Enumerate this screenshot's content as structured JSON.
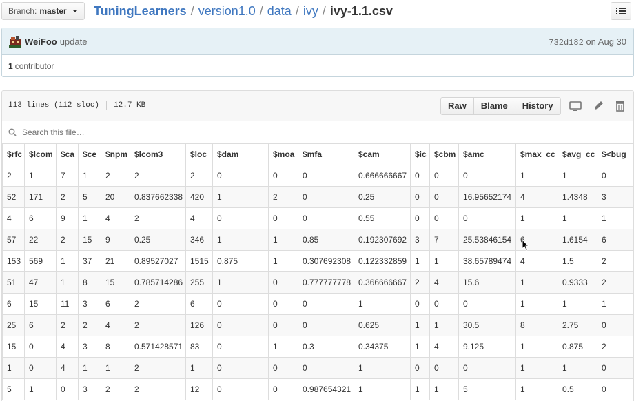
{
  "branch": {
    "prefix": "Branch:",
    "name": "master"
  },
  "breadcrumb": [
    {
      "label": "TuningLearners",
      "kind": "repo"
    },
    {
      "label": "version1.0",
      "kind": "dir"
    },
    {
      "label": "data",
      "kind": "dir"
    },
    {
      "label": "ivy",
      "kind": "dir"
    },
    {
      "label": "ivy-1.1.csv",
      "kind": "file"
    }
  ],
  "breadcrumb_separator": "/",
  "commit": {
    "author": "WeiFoo",
    "message": "update",
    "sha": "732d182",
    "date": "on Aug 30",
    "contributors_count": "1",
    "contributors_label": "contributor"
  },
  "file": {
    "lines": "113 lines (112 sloc)",
    "size": "12.7 KB",
    "buttons": [
      "Raw",
      "Blame",
      "History"
    ],
    "icons": [
      "desktop-icon",
      "pencil-icon",
      "trash-icon"
    ]
  },
  "search": {
    "placeholder": "Search this file…"
  },
  "table": {
    "headers": [
      "$rfc",
      "$lcom",
      "$ca",
      "$ce",
      "$npm",
      "$lcom3",
      "$loc",
      "$dam",
      "$moa",
      "$mfa",
      "$cam",
      "$ic",
      "$cbm",
      "$amc",
      "$max_cc",
      "$avg_cc",
      "$<bug"
    ],
    "rows": [
      [
        "2",
        "1",
        "7",
        "1",
        "2",
        "2",
        "2",
        "0",
        "0",
        "0",
        "0.666666667",
        "0",
        "0",
        "0",
        "1",
        "1",
        "0"
      ],
      [
        "52",
        "171",
        "2",
        "5",
        "20",
        "0.837662338",
        "420",
        "1",
        "2",
        "0",
        "0.25",
        "0",
        "0",
        "16.95652174",
        "4",
        "1.4348",
        "3"
      ],
      [
        "4",
        "6",
        "9",
        "1",
        "4",
        "2",
        "4",
        "0",
        "0",
        "0",
        "0.55",
        "0",
        "0",
        "0",
        "1",
        "1",
        "1"
      ],
      [
        "57",
        "22",
        "2",
        "15",
        "9",
        "0.25",
        "346",
        "1",
        "1",
        "0.85",
        "0.192307692",
        "3",
        "7",
        "25.53846154",
        "6",
        "1.6154",
        "6"
      ],
      [
        "153",
        "569",
        "1",
        "37",
        "21",
        "0.89527027",
        "1515",
        "0.875",
        "1",
        "0.307692308",
        "0.122332859",
        "1",
        "1",
        "38.65789474",
        "4",
        "1.5",
        "2"
      ],
      [
        "51",
        "47",
        "1",
        "8",
        "15",
        "0.785714286",
        "255",
        "1",
        "0",
        "0.777777778",
        "0.366666667",
        "2",
        "4",
        "15.6",
        "1",
        "0.9333",
        "2"
      ],
      [
        "6",
        "15",
        "11",
        "3",
        "6",
        "2",
        "6",
        "0",
        "0",
        "0",
        "1",
        "0",
        "0",
        "0",
        "1",
        "1",
        "1"
      ],
      [
        "25",
        "6",
        "2",
        "2",
        "4",
        "2",
        "126",
        "0",
        "0",
        "0",
        "0.625",
        "1",
        "1",
        "30.5",
        "8",
        "2.75",
        "0"
      ],
      [
        "15",
        "0",
        "4",
        "3",
        "8",
        "0.571428571",
        "83",
        "0",
        "1",
        "0.3",
        "0.34375",
        "1",
        "4",
        "9.125",
        "1",
        "0.875",
        "2"
      ],
      [
        "1",
        "0",
        "4",
        "1",
        "1",
        "2",
        "1",
        "0",
        "0",
        "0",
        "1",
        "0",
        "0",
        "0",
        "1",
        "1",
        "0"
      ],
      [
        "5",
        "1",
        "0",
        "3",
        "2",
        "2",
        "12",
        "0",
        "0",
        "0.987654321",
        "1",
        "1",
        "1",
        "5",
        "1",
        "0.5",
        "0"
      ]
    ]
  },
  "colors": {
    "link": "#4078c0",
    "commit_bg": "#e6f1f6",
    "border": "#dddddd"
  }
}
